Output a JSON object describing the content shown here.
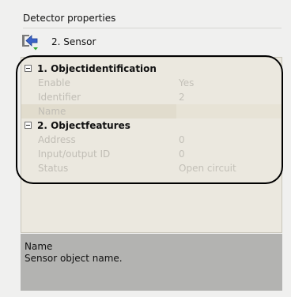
{
  "panel": {
    "title": "Detector properties"
  },
  "object": {
    "icon": "sensor-exit-icon",
    "label": "2. Sensor"
  },
  "property_grid": {
    "categories": [
      {
        "label": "1. Objectidentification",
        "rows": [
          {
            "name": "Enable",
            "value": "Yes"
          },
          {
            "name": "Identifier",
            "value": "2"
          },
          {
            "name": "Name",
            "value": ""
          }
        ]
      },
      {
        "label": "2. Objectfeatures",
        "rows": [
          {
            "name": "Address",
            "value": "0"
          },
          {
            "name": "Input/output ID",
            "value": "0"
          },
          {
            "name": "Status",
            "value": "Open circuit"
          }
        ]
      }
    ]
  },
  "description": {
    "title": "Name",
    "text": "Sensor object name."
  },
  "colors": {
    "grid_bg": "#ebe8df",
    "desc_bg": "#b3b3b1",
    "selected_row": "#e1dccd"
  }
}
